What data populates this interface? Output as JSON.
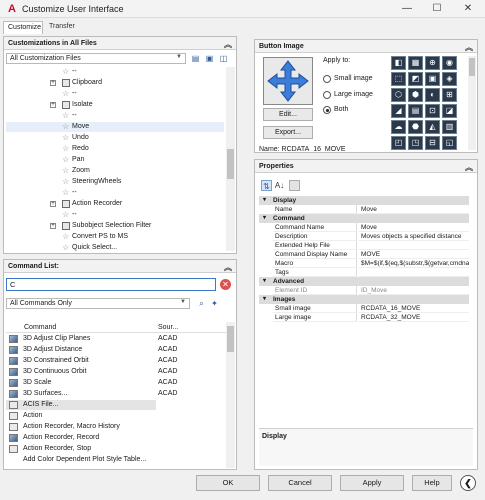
{
  "window": {
    "title": "Customize User Interface",
    "app_icon": "A",
    "minimize": "—",
    "maximize": "☐",
    "close": "✕"
  },
  "tabs": [
    {
      "label": "Customize"
    },
    {
      "label": "Transfer"
    }
  ],
  "customizations": {
    "header": "Customizations in All Files",
    "filter_value": "All Customization Files",
    "tree": [
      {
        "label": "--"
      },
      {
        "label": "Clipboard"
      },
      {
        "label": "--"
      },
      {
        "label": "Isolate"
      },
      {
        "label": "--"
      },
      {
        "label": "Move"
      },
      {
        "label": "Undo"
      },
      {
        "label": "Redo"
      },
      {
        "label": "Pan"
      },
      {
        "label": "Zoom"
      },
      {
        "label": "SteeringWheels"
      },
      {
        "label": "--"
      },
      {
        "label": "Action Recorder"
      },
      {
        "label": "--"
      },
      {
        "label": "Subobject Selection Filter"
      },
      {
        "label": "Convert PS to MS"
      },
      {
        "label": "Quick Select..."
      }
    ]
  },
  "command_list": {
    "header": "Command List:",
    "search_value": "C",
    "filter_value": "All Commands Only",
    "col_command": "Command",
    "col_source": "Sour...",
    "rows": [
      {
        "name": "3D Adjust Clip Planes",
        "source": "ACAD"
      },
      {
        "name": "3D Adjust Distance",
        "source": "ACAD"
      },
      {
        "name": "3D Constrained Orbit",
        "source": "ACAD"
      },
      {
        "name": "3D Continuous Orbit",
        "source": "ACAD"
      },
      {
        "name": "3D Scale",
        "source": "ACAD"
      },
      {
        "name": "3D Surfaces...",
        "source": "ACAD"
      },
      {
        "name": "ACIS File...",
        "source": ""
      },
      {
        "name": "Action",
        "source": ""
      },
      {
        "name": "Action Recorder, Macro History",
        "source": ""
      },
      {
        "name": "Action Recorder, Record",
        "source": ""
      },
      {
        "name": "Action Recorder, Stop",
        "source": ""
      },
      {
        "name": "Add Color Dependent Plot Style Table...",
        "source": ""
      }
    ]
  },
  "button_image": {
    "header": "Button Image",
    "apply_to": "Apply to:",
    "small": "Small image",
    "large": "Large image",
    "both": "Both",
    "edit": "Edit...",
    "export": "Export...",
    "name_partial": "Name: RCDATA_16_MOVE"
  },
  "properties": {
    "header": "Properties",
    "categories": [
      {
        "label": "Display",
        "rows": [
          {
            "name": "Name",
            "value": "Move"
          }
        ]
      },
      {
        "label": "Command",
        "rows": [
          {
            "name": "Command Name",
            "value": "Move"
          },
          {
            "name": "Description",
            "value": "Moves objects a specified distance"
          },
          {
            "name": "Extended Help File",
            "value": ""
          },
          {
            "name": "Command Display Name",
            "value": "MOVE"
          },
          {
            "name": "Macro",
            "value": "$M=$(if,$(eq,$(substr,$(getvar,cmdnames"
          },
          {
            "name": "Tags",
            "value": ""
          }
        ]
      },
      {
        "label": "Advanced",
        "rows": [
          {
            "name": "Element ID",
            "value": "ID_Move"
          }
        ]
      },
      {
        "label": "Images",
        "rows": [
          {
            "name": "Small image",
            "value": "RCDATA_16_MOVE"
          },
          {
            "name": "Large image",
            "value": "RCDATA_32_MOVE"
          }
        ]
      }
    ],
    "description_title": "Display"
  },
  "footer": {
    "ok": "OK",
    "cancel": "Cancel",
    "apply": "Apply",
    "help": "Help"
  }
}
